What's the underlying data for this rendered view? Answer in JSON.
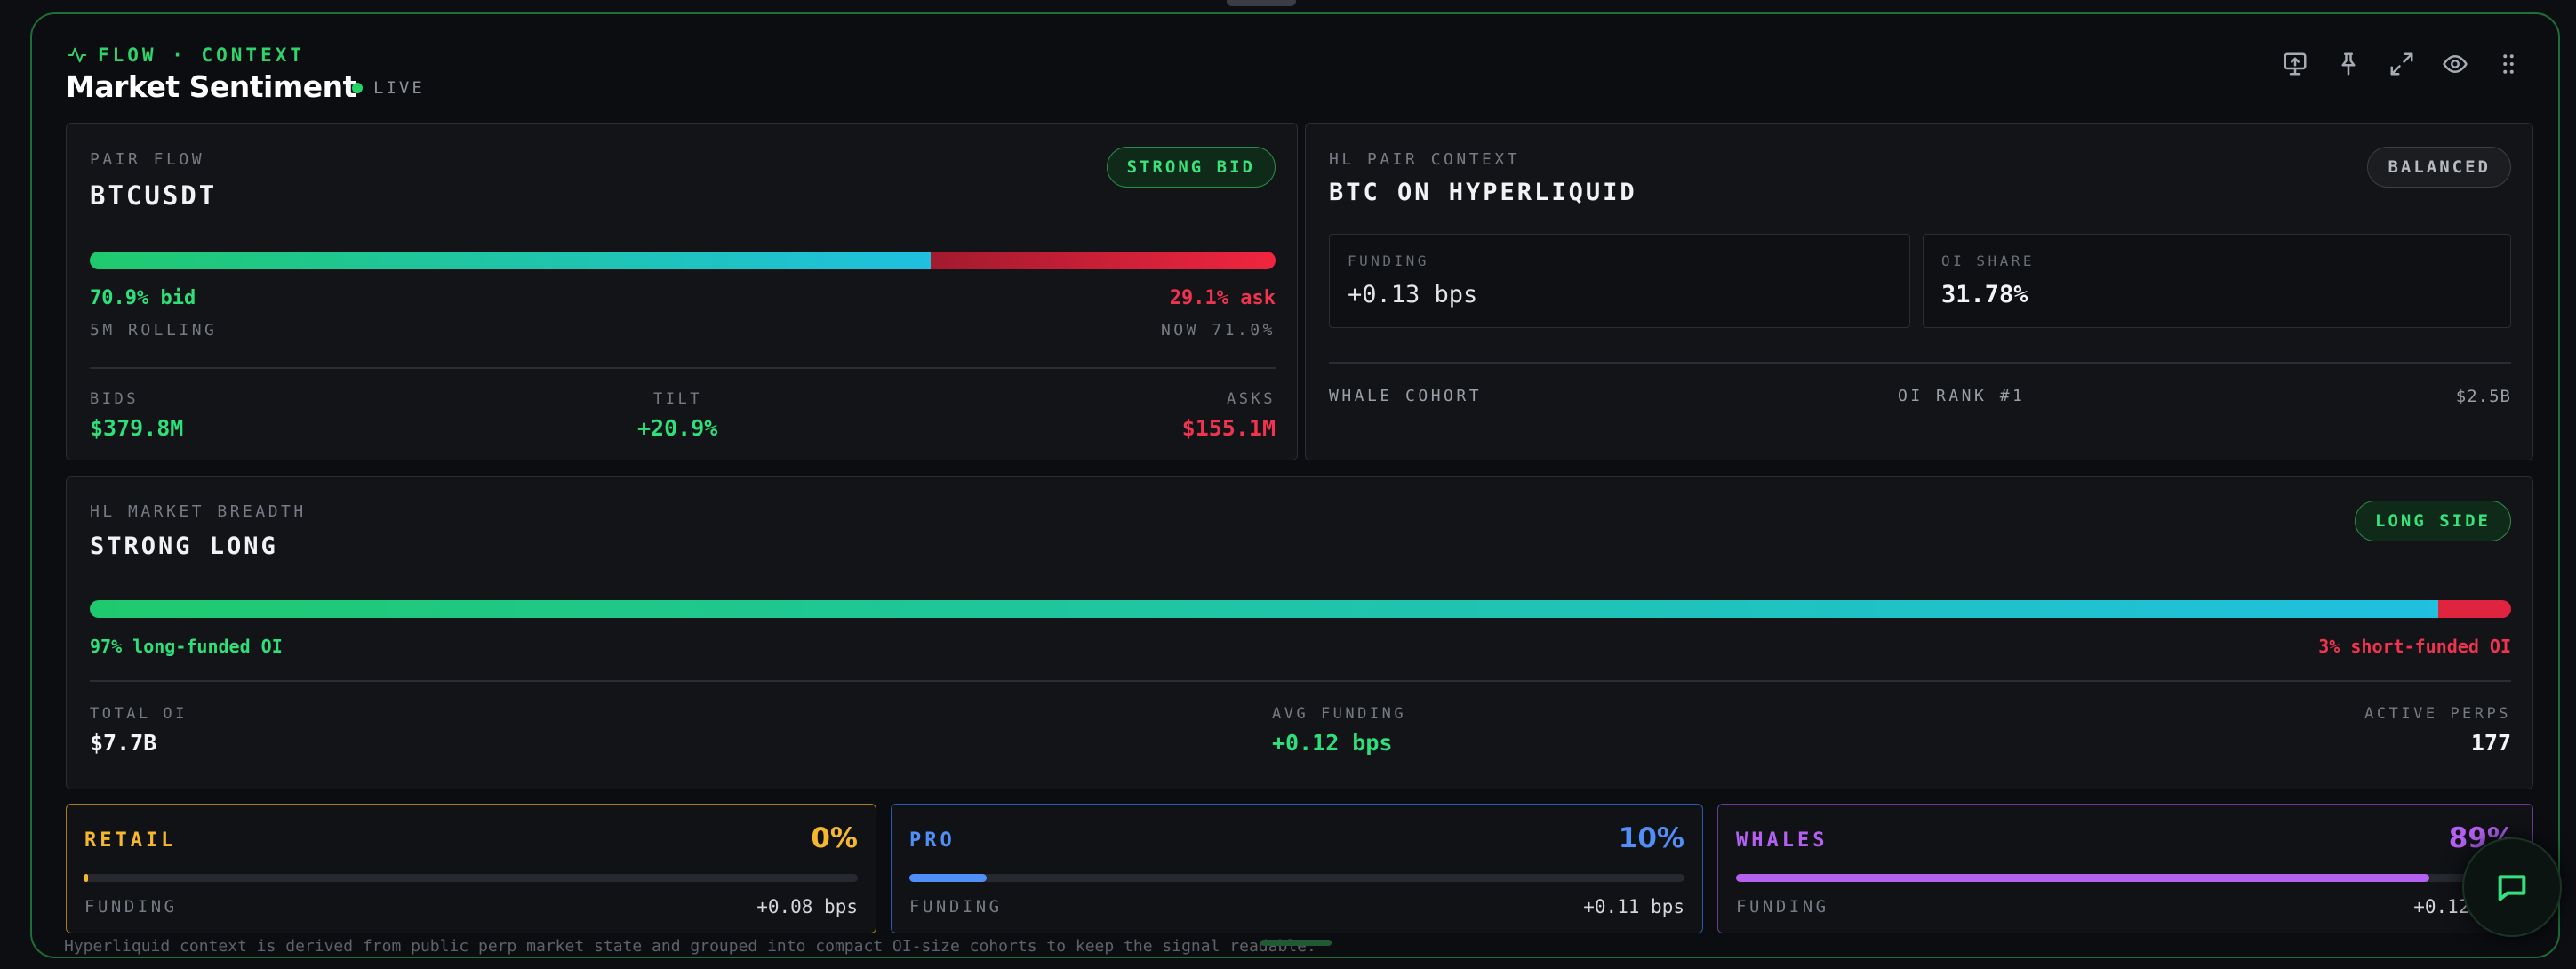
{
  "header": {
    "tag": "FLOW · CONTEXT",
    "title": "Market Sentiment",
    "live_label": "LIVE"
  },
  "toolbar": [
    "monitor-upload-icon",
    "pin-icon",
    "expand-icon",
    "eye-icon",
    "drag-grip-icon"
  ],
  "pair_flow": {
    "label": "PAIR FLOW",
    "pair": "BTCUSDT",
    "badge": "STRONG BID",
    "bid_pct_value": 70.9,
    "bid_text": "70.9% bid",
    "ask_text": "29.1% ask",
    "window": "5M ROLLING",
    "now": "NOW 71.0%",
    "stats": {
      "bids_label": "BIDS",
      "bids_value": "$379.8M",
      "tilt_label": "TILT",
      "tilt_value": "+20.9%",
      "asks_label": "ASKS",
      "asks_value": "$155.1M"
    }
  },
  "hl_pair": {
    "label": "HL PAIR CONTEXT",
    "title": "BTC ON HYPERLIQUID",
    "badge": "BALANCED",
    "funding_label": "FUNDING",
    "funding_value": "+0.13 bps",
    "oi_share_label": "OI SHARE",
    "oi_share_value": "31.78%",
    "whale_label": "WHALE COHORT",
    "oi_rank": "OI RANK #1",
    "whale_value": "$2.5B"
  },
  "breadth": {
    "label": "HL MARKET BREADTH",
    "title": "STRONG LONG",
    "badge": "LONG SIDE",
    "long_pct_value": 97,
    "long_text": "97% long-funded OI",
    "short_text": "3% short-funded OI",
    "total_oi_label": "TOTAL OI",
    "total_oi_value": "$7.7B",
    "avg_funding_label": "AVG FUNDING",
    "avg_funding_value": "+0.12 bps",
    "active_perps_label": "ACTIVE PERPS",
    "active_perps_value": "177"
  },
  "cohorts": [
    {
      "name": "RETAIL",
      "pct": "0%",
      "fill_pct": 0.5,
      "funding_label": "FUNDING",
      "funding": "+0.08 bps",
      "color": "#f5b72b",
      "border": "#b07a17"
    },
    {
      "name": "PRO",
      "pct": "10%",
      "fill_pct": 10,
      "funding_label": "FUNDING",
      "funding": "+0.11 bps",
      "color": "#4f8ff7",
      "border": "#2d5aa8"
    },
    {
      "name": "WHALES",
      "pct": "89%",
      "fill_pct": 89,
      "funding_label": "FUNDING",
      "funding": "+0.12 bps",
      "color": "#b461f2",
      "border": "#6e3a9a"
    }
  ],
  "footer": "Hyperliquid context is derived from public perp market state and grouped into compact OI-size cohorts to keep the signal readable."
}
